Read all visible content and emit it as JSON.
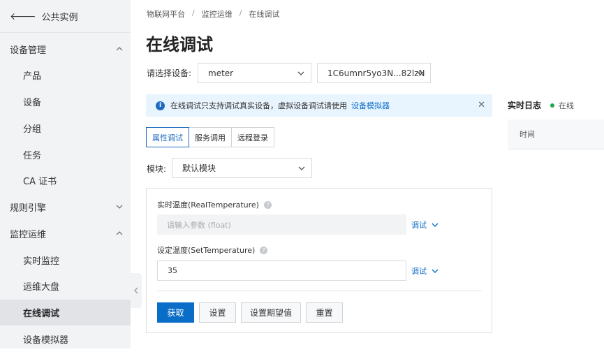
{
  "sidebar": {
    "back_label": "公共实例",
    "items": [
      {
        "label": "设备管理"
      },
      {
        "label": "产品"
      },
      {
        "label": "设备"
      },
      {
        "label": "分组"
      },
      {
        "label": "任务"
      },
      {
        "label": "CA 证书"
      },
      {
        "label": "规则引擎"
      },
      {
        "label": "监控运维"
      },
      {
        "label": "实时监控"
      },
      {
        "label": "运维大盘"
      },
      {
        "label": "在线调试"
      },
      {
        "label": "设备模拟器"
      }
    ]
  },
  "breadcrumb": [
    "物联网平台",
    "监控运维",
    "在线调试"
  ],
  "page_title": "在线调试",
  "device_select": {
    "label": "请选择设备:",
    "product_value": "meter",
    "device_value": "1C6umnr5yo3N...82lzN"
  },
  "notice": {
    "text": "在线调试只支持调试真实设备，虚拟设备调试请使用",
    "link": "设备模拟器",
    "close": "✕"
  },
  "tabs": [
    {
      "label": "属性调试"
    },
    {
      "label": "服务调用"
    },
    {
      "label": "远程登录"
    }
  ],
  "module": {
    "label": "模块:",
    "value": "默认模块"
  },
  "fields": [
    {
      "label": "实时温度(RealTemperature)",
      "placeholder": "请输入参数 (float)",
      "value": "",
      "action": "调试"
    },
    {
      "label": "设定温度(SetTemperature)",
      "placeholder": "",
      "value": "35",
      "action": "调试"
    }
  ],
  "buttons": {
    "get": "获取",
    "set": "设置",
    "set_expected": "设置期望值",
    "reset": "重置"
  },
  "log": {
    "title": "实时日志",
    "status": "在线",
    "column_time": "时间"
  },
  "colors": {
    "accent": "#0a6dc8",
    "online": "#1fa84f",
    "sidebar_bg": "#f2f3f5"
  }
}
